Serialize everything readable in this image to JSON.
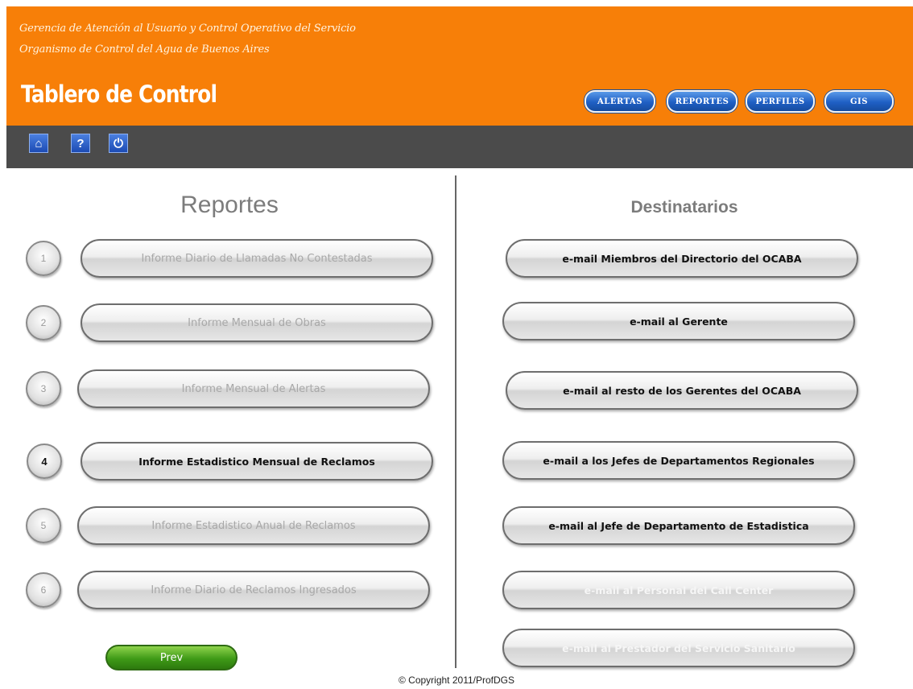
{
  "header": {
    "subtitle_line1": "Gerencia de Atención al Usuario y Control Operativo del Servicio",
    "subtitle_line2": "Organismo de Control del Agua de Buenos Aires",
    "title": "Tablero de Control",
    "nav": [
      "ALERTAS",
      "REPORTES",
      "PERFILES",
      "GIS"
    ],
    "background_color": "#f77f08"
  },
  "toolbar": {
    "icons": [
      {
        "name": "home-icon",
        "glyph": "⌂"
      },
      {
        "name": "help-icon",
        "glyph": "?"
      },
      {
        "name": "power-icon",
        "glyph": "⏻"
      }
    ]
  },
  "reportes": {
    "title": "Reportes",
    "items": [
      {
        "number": "1",
        "label": "Informe Diario de Llamadas No Contestadas",
        "state": "disabled"
      },
      {
        "number": "2",
        "label": "Informe Mensual de Obras",
        "state": "disabled"
      },
      {
        "number": "3",
        "label": "Informe Mensual de Alertas",
        "state": "disabled"
      },
      {
        "number": "4",
        "label": "Informe Estadistico Mensual de Reclamos",
        "state": "active"
      },
      {
        "number": "5",
        "label": "Informe Estadistico Anual de Reclamos",
        "state": "disabled"
      },
      {
        "number": "6",
        "label": "Informe Diario de Reclamos Ingresados",
        "state": "disabled"
      }
    ],
    "prev_label": "Prev"
  },
  "destinatarios": {
    "title": "Destinatarios",
    "items": [
      {
        "label": "e-mail Miembros del Directorio del OCABA",
        "state": "active"
      },
      {
        "label": "e-mail al Gerente",
        "state": "active"
      },
      {
        "label": "e-mail al resto de los Gerentes del OCABA",
        "state": "active"
      },
      {
        "label": "e-mail a los Jefes de Departamentos Regionales",
        "state": "active"
      },
      {
        "label": "e-mail al Jefe de Departamento de Estadistica",
        "state": "active"
      },
      {
        "label": "e-mail al Personal del Call Center",
        "state": "disabled"
      },
      {
        "label": "e-mail al Prestador del Servicio Sanitario",
        "state": "disabled"
      }
    ]
  },
  "footer": {
    "copyright": "© Copyright 2011/ProfDGS"
  }
}
